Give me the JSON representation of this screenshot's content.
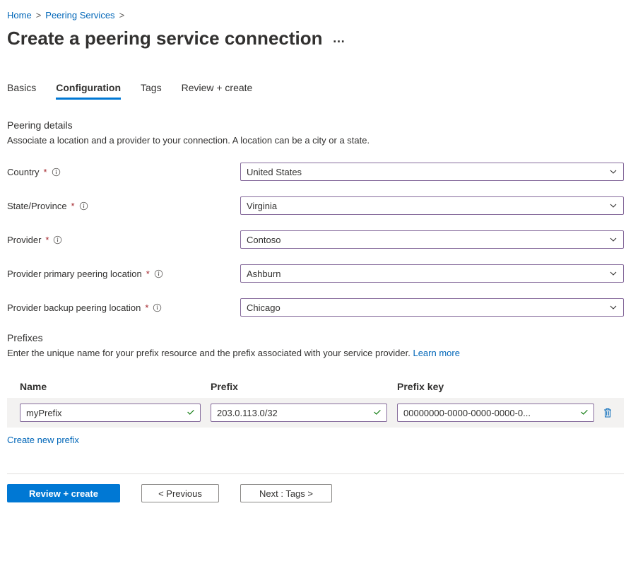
{
  "breadcrumb": {
    "home": "Home",
    "peering_services": "Peering Services"
  },
  "page_title": "Create a peering service connection",
  "tabs": {
    "basics": "Basics",
    "configuration": "Configuration",
    "tags": "Tags",
    "review_create": "Review + create",
    "active": "configuration"
  },
  "peering_details": {
    "title": "Peering details",
    "description": "Associate a location and a provider to your connection. A location can be a city or a state.",
    "fields": {
      "country": {
        "label": "Country",
        "value": "United States"
      },
      "state": {
        "label": "State/Province",
        "value": "Virginia"
      },
      "provider": {
        "label": "Provider",
        "value": "Contoso"
      },
      "primary_location": {
        "label": "Provider primary peering location",
        "value": "Ashburn"
      },
      "backup_location": {
        "label": "Provider backup peering location",
        "value": "Chicago"
      }
    }
  },
  "prefixes": {
    "title": "Prefixes",
    "description": "Enter the unique name for your prefix resource and the prefix associated with your service provider. ",
    "learn_more": "Learn more",
    "columns": {
      "name": "Name",
      "prefix": "Prefix",
      "prefix_key": "Prefix key"
    },
    "rows": [
      {
        "name": "myPrefix",
        "prefix": "203.0.113.0/32",
        "prefix_key": "00000000-0000-0000-0000-0..."
      }
    ],
    "create_new": "Create new prefix"
  },
  "footer": {
    "review_create": "Review + create",
    "previous": "< Previous",
    "next": "Next : Tags >"
  }
}
